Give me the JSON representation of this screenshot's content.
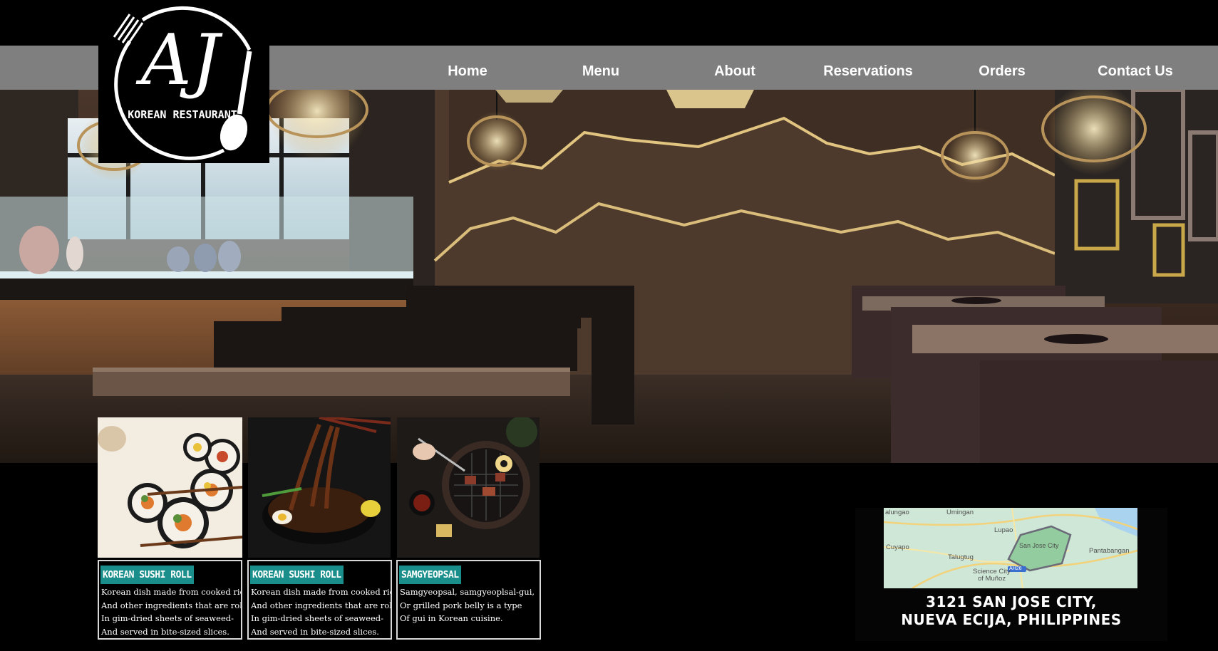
{
  "logo": {
    "initials": "AJ",
    "tagline": "KOREAN RESTAURANT"
  },
  "nav": {
    "items": [
      {
        "label": "Home"
      },
      {
        "label": "Menu"
      },
      {
        "label": "About"
      },
      {
        "label": "Reservations"
      },
      {
        "label": "Orders"
      },
      {
        "label": "Contact Us"
      }
    ]
  },
  "hero": {
    "image": "restaurant-interior-photo"
  },
  "dishes": [
    {
      "image": "kimbap-photo",
      "title": "KOREAN SUSHI ROLL",
      "lines": [
        "Korean dish made from cooked rice",
        "And other ingredients that are rolled",
        "In gim-dried sheets of seaweed-",
        "And served in bite-sized slices."
      ]
    },
    {
      "image": "jajangmyeon-photo",
      "title": "KOREAN SUSHI ROLL",
      "lines": [
        "Korean dish made from cooked rice",
        "And other ingredients that are rolled",
        "In gim-dried sheets of seaweed-",
        "And served in bite-sized slices."
      ]
    },
    {
      "image": "samgyeopsal-photo",
      "title": "SAMGYEOPSAL",
      "lines": [
        "Samgyeopsal, samgyeoplsal-gui,",
        "Or grilled pork belly is a type",
        "Of gui in Korean cuisine."
      ]
    }
  ],
  "map": {
    "labels": {
      "lalungao": "alungao",
      "umingan": "Umingan",
      "lupao": "Lupao",
      "cuyapo": "Cuyapo",
      "san_jose": "San Jose City",
      "pantabangan": "Pantabangan",
      "talugtug": "Talugtug",
      "science_city": "Science City",
      "munoz": "of Muñoz",
      "road": "AH26"
    },
    "address_line1": "3121 SAN JOSE CITY,",
    "address_line2": "NUEVA ECIJA, PHILIPPINES"
  },
  "colors": {
    "background": "#000000",
    "nav_bar": "#7f7f7f",
    "nav_text": "#ffffff",
    "caption_tag": "#198e8a",
    "caption_border": "#d8d8d8",
    "map_land": "#cfe7d6",
    "map_highlight": "#93cc9e"
  }
}
